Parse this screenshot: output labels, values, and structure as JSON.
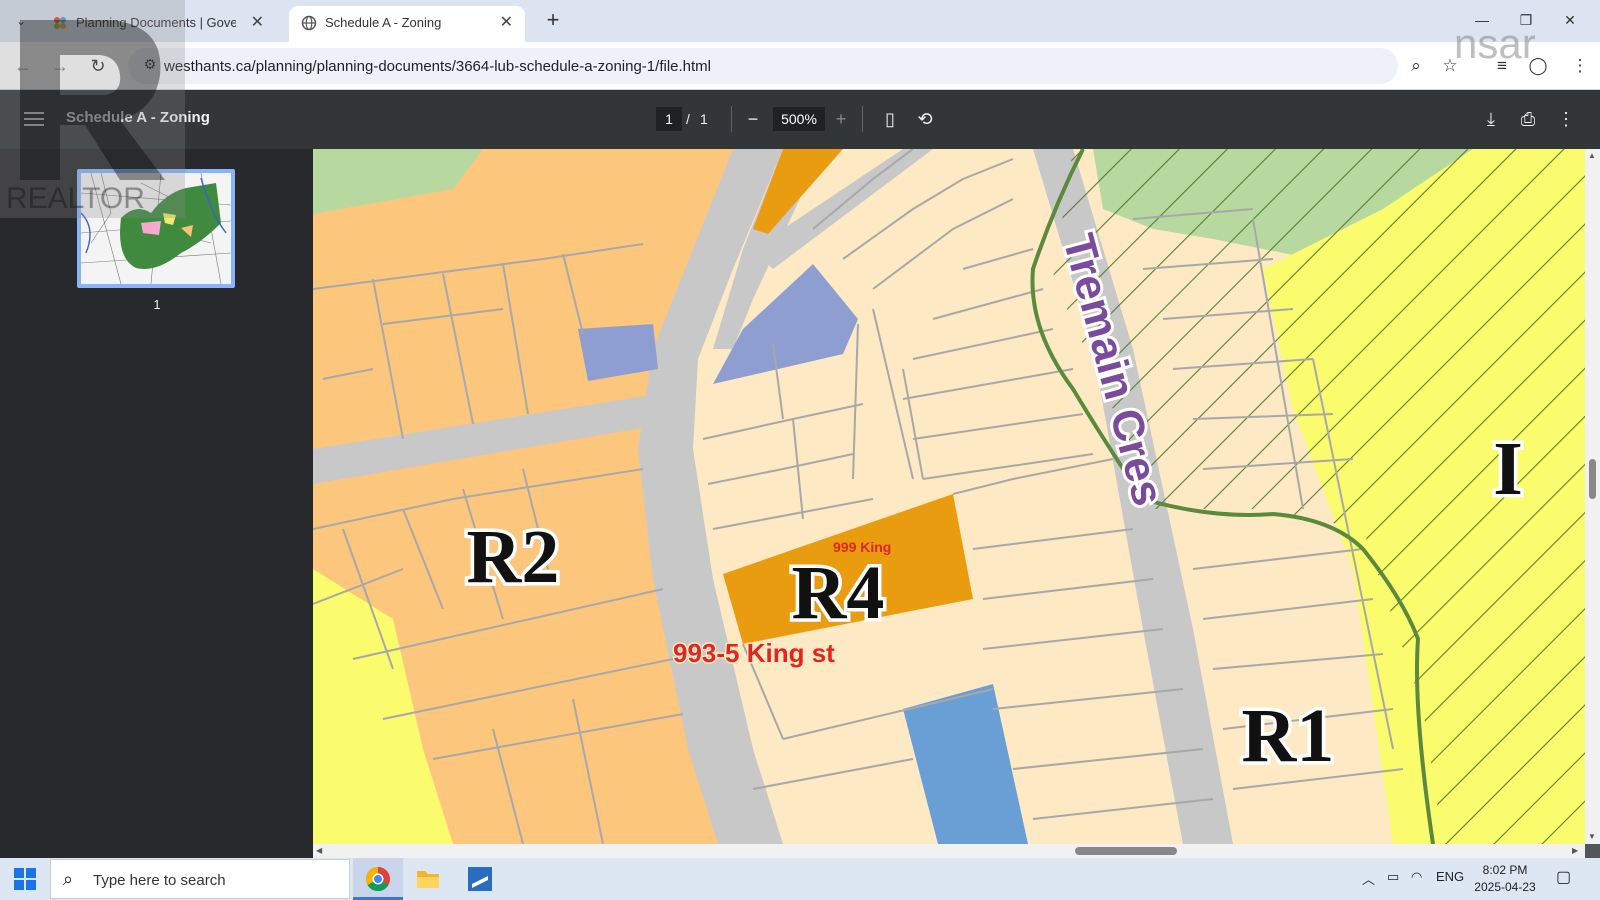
{
  "browser": {
    "tabs": [
      {
        "title": "Planning Documents | Governm",
        "active": false
      },
      {
        "title": "Schedule A - Zoning",
        "active": true
      }
    ],
    "url": "westhants.ca/planning/planning-documents/3664-lub-schedule-a-zoning-1/file.html"
  },
  "pdf": {
    "title": "Schedule A - Zoning",
    "current_page": "1",
    "page_separator": "/",
    "total_pages": "1",
    "zoom": "500%",
    "thumbnail_label": "1"
  },
  "map": {
    "zone_labels": {
      "r1": "R1",
      "r2": "R2",
      "r4": "R4",
      "i": "I"
    },
    "street_label": "Tremain Cres",
    "annotations": {
      "small": "999 King",
      "large": "993-5 King st"
    },
    "colors": {
      "r1": "#fde9c4",
      "r2": "#fcc67d",
      "r4": "#e99c0f",
      "road": "#c8c8c8",
      "park": "#b7d9a0",
      "institutional": "#fbfb6e",
      "blue_zone": "#8e9ed0",
      "water_blue": "#6a9fd6",
      "green_line": "#5b8a3c",
      "annotation_red": "#e0261e",
      "street_purple": "#7a4a9c"
    }
  },
  "taskbar": {
    "search_placeholder": "Type here to search",
    "language": "ENG",
    "time": "8:02 PM",
    "date": "2025-04-23"
  },
  "watermarks": {
    "realtor": "REALTOR",
    "nsar": "nsar"
  }
}
